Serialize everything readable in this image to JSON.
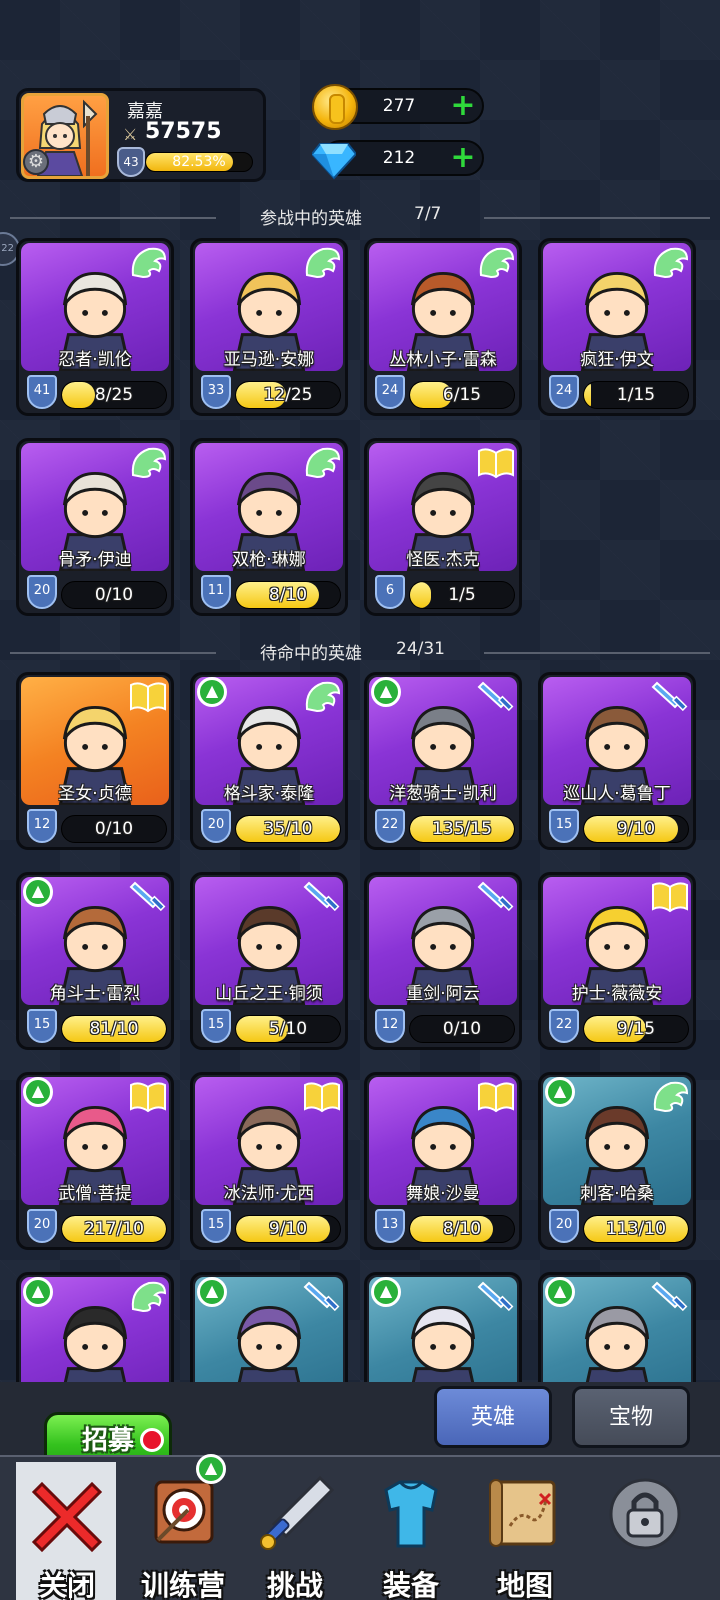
{
  "player": {
    "name": "嘉嘉",
    "power": "57575",
    "level": "43",
    "xp_text": "82.53%",
    "xp_fraction": 0.8253
  },
  "resources": {
    "gold": "277",
    "gems": "212"
  },
  "side_badge": "22",
  "sections": {
    "active": {
      "title": "参战中的英雄",
      "count": "7/7"
    },
    "standby": {
      "title": "待命中的英雄",
      "count": "24/31"
    }
  },
  "active_heroes": [
    {
      "name": "忍者·凯伦",
      "level": "41",
      "progress": "8/25",
      "fill": 0.32,
      "bg": "purple",
      "type": "wing-icon",
      "upgrade": false
    },
    {
      "name": "亚马逊·安娜",
      "level": "33",
      "progress": "12/25",
      "fill": 0.48,
      "bg": "purple",
      "type": "wing-icon",
      "upgrade": false
    },
    {
      "name": "丛林小子·雷森",
      "level": "24",
      "progress": "6/15",
      "fill": 0.4,
      "bg": "purple",
      "type": "wing-icon",
      "upgrade": false
    },
    {
      "name": "疯狂·伊文",
      "level": "24",
      "progress": "1/15",
      "fill": 0.07,
      "bg": "purple",
      "type": "wing-icon",
      "upgrade": false
    },
    {
      "name": "骨矛·伊迪",
      "level": "20",
      "progress": "0/10",
      "fill": 0,
      "bg": "purple",
      "type": "wing-icon",
      "upgrade": false
    },
    {
      "name": "双枪·琳娜",
      "level": "11",
      "progress": "8/10",
      "fill": 0.8,
      "bg": "purple",
      "type": "wing-icon",
      "upgrade": false
    },
    {
      "name": "怪医·杰克",
      "level": "6",
      "progress": "1/5",
      "fill": 0.2,
      "bg": "purple",
      "type": "book-icon",
      "upgrade": false
    }
  ],
  "standby_heroes": [
    {
      "name": "圣女·贞德",
      "level": "12",
      "progress": "0/10",
      "fill": 0,
      "bg": "orange",
      "type": "book-icon",
      "upgrade": false
    },
    {
      "name": "格斗家·泰隆",
      "level": "20",
      "progress": "35/10",
      "fill": 1,
      "bg": "purple",
      "type": "wing-icon",
      "upgrade": true
    },
    {
      "name": "洋葱骑士·凯利",
      "level": "22",
      "progress": "135/15",
      "fill": 1,
      "bg": "purple",
      "type": "sword-icon",
      "upgrade": true
    },
    {
      "name": "巡山人·葛鲁丁",
      "level": "15",
      "progress": "9/10",
      "fill": 0.9,
      "bg": "purple",
      "type": "sword-icon",
      "upgrade": false
    },
    {
      "name": "角斗士·雷烈",
      "level": "15",
      "progress": "81/10",
      "fill": 1,
      "bg": "purple",
      "type": "sword-icon",
      "upgrade": true
    },
    {
      "name": "山丘之王·铜须",
      "level": "15",
      "progress": "5/10",
      "fill": 0.5,
      "bg": "purple",
      "type": "sword-icon",
      "upgrade": false
    },
    {
      "name": "重剑·阿云",
      "level": "12",
      "progress": "0/10",
      "fill": 0,
      "bg": "purple",
      "type": "sword-icon",
      "upgrade": false
    },
    {
      "name": "护士·薇薇安",
      "level": "22",
      "progress": "9/15",
      "fill": 0.6,
      "bg": "purple",
      "type": "book-icon",
      "upgrade": false
    },
    {
      "name": "武僧·菩提",
      "level": "20",
      "progress": "217/10",
      "fill": 1,
      "bg": "purple",
      "type": "book-icon",
      "upgrade": true
    },
    {
      "name": "冰法师·尤西",
      "level": "15",
      "progress": "9/10",
      "fill": 0.9,
      "bg": "purple",
      "type": "book-icon",
      "upgrade": false
    },
    {
      "name": "舞娘·沙曼",
      "level": "13",
      "progress": "8/10",
      "fill": 0.8,
      "bg": "purple",
      "type": "book-icon",
      "upgrade": false
    },
    {
      "name": "刺客·哈桑",
      "level": "20",
      "progress": "113/10",
      "fill": 1,
      "bg": "teal",
      "type": "wing-icon",
      "upgrade": true
    },
    {
      "name": "",
      "level": "",
      "progress": "",
      "fill": 0,
      "bg": "purple",
      "type": "wing-icon",
      "upgrade": true
    },
    {
      "name": "",
      "level": "",
      "progress": "",
      "fill": 0,
      "bg": "teal",
      "type": "sword-icon",
      "upgrade": true
    },
    {
      "name": "",
      "level": "",
      "progress": "",
      "fill": 0,
      "bg": "teal",
      "type": "sword-icon",
      "upgrade": true
    },
    {
      "name": "",
      "level": "",
      "progress": "",
      "fill": 0,
      "bg": "teal",
      "type": "sword-icon",
      "upgrade": true
    }
  ],
  "recruit_label": "招募",
  "tabs": {
    "heroes": "英雄",
    "treasure": "宝物"
  },
  "nav": {
    "close": "关闭",
    "training": "训练营",
    "challenge": "挑战",
    "equipment": "装备",
    "map": "地图"
  },
  "colors": {
    "upgrade_green": "#29b13a",
    "progress_yellow": "#f5c814",
    "card_purple": "#8a34d6"
  }
}
